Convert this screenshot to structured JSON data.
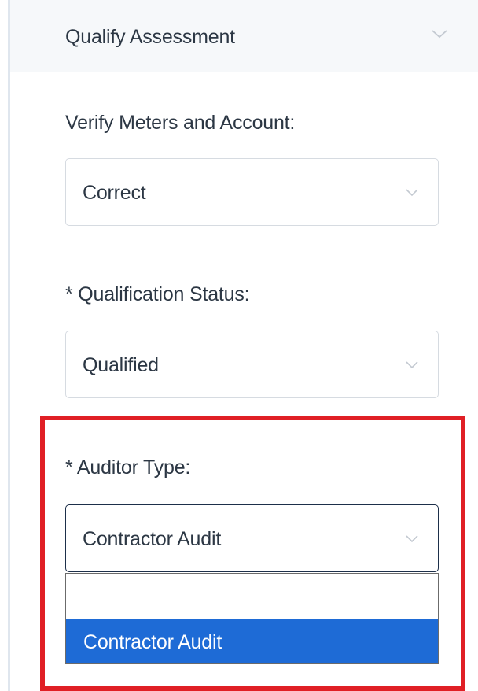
{
  "section": {
    "title": "Qualify Assessment",
    "chevron_icon": "chevron-down-icon"
  },
  "fields": {
    "verify_meters": {
      "label": "Verify Meters and Account:",
      "value": "Correct"
    },
    "qualification_status": {
      "label": "* Qualification Status:",
      "value": "Qualified"
    },
    "auditor_type": {
      "label": "* Auditor Type:",
      "value": "Contractor Audit",
      "options": [
        "",
        "Contractor Audit"
      ],
      "selected_option": "Contractor Audit"
    }
  },
  "colors": {
    "highlight_border": "#e01f25",
    "selected_option_bg": "#1e6bd6",
    "text": "#2c3744"
  }
}
